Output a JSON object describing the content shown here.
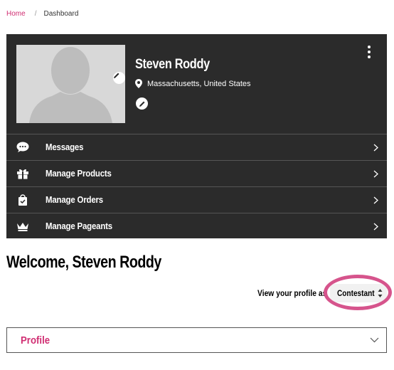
{
  "breadcrumb": {
    "home": "Home",
    "separator": "/",
    "current": "Dashboard"
  },
  "profile": {
    "name": "Steven Roddy",
    "location": "Massachusetts, United States"
  },
  "menu": {
    "items": [
      {
        "label": "Messages",
        "icon": "chat-bubble-icon"
      },
      {
        "label": "Manage Products",
        "icon": "gift-box-icon"
      },
      {
        "label": "Manage Orders",
        "icon": "shopping-bag-icon"
      },
      {
        "label": "Manage Pageants",
        "icon": "crown-icon"
      }
    ]
  },
  "welcome": "Welcome, Steven Roddy",
  "view_as": {
    "label": "View your profile as",
    "selected": "Contestant"
  },
  "accordion": {
    "label": "Profile"
  },
  "colors": {
    "accent": "#d02e72",
    "card_bg": "#2b2b2b",
    "highlight_ring": "#d6548c"
  }
}
